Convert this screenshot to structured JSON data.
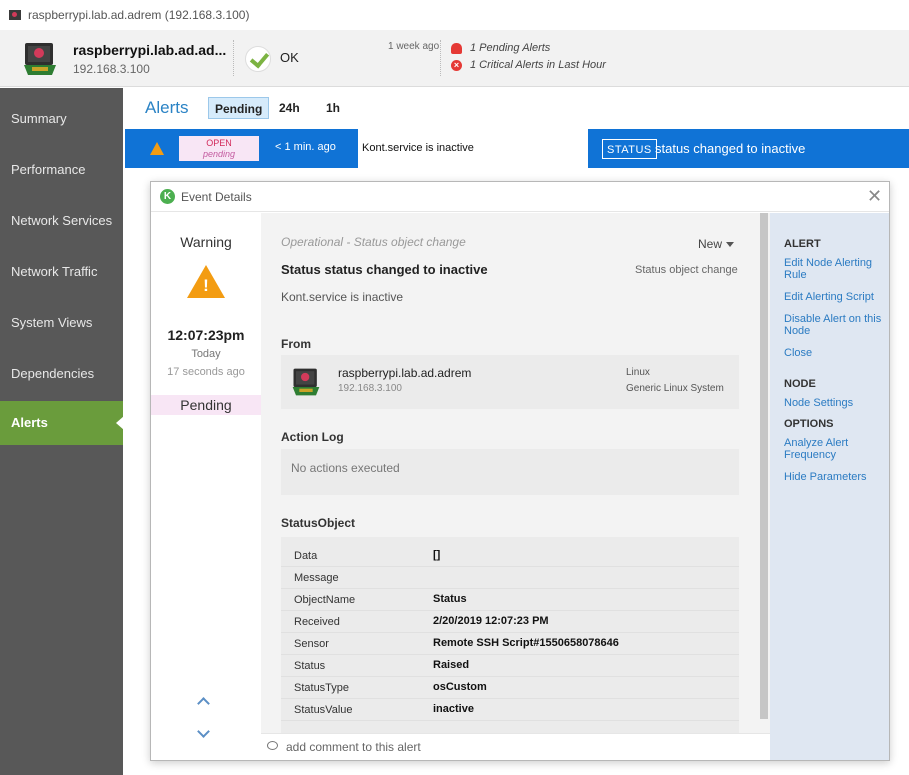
{
  "titlebar": {
    "text": "raspberrypi.lab.ad.adrem (192.168.3.100)"
  },
  "node": {
    "name": "raspberrypi.lab.ad.ad...",
    "ip": "192.168.3.100",
    "status": "OK",
    "status_age": "1 week ago",
    "pending_alerts": "1 Pending Alerts",
    "critical_alerts": "1 Critical Alerts in Last Hour"
  },
  "sidebar": {
    "items": [
      {
        "label": "Summary"
      },
      {
        "label": "Performance"
      },
      {
        "label": "Network Services"
      },
      {
        "label": "Network Traffic"
      },
      {
        "label": "System Views"
      },
      {
        "label": "Dependencies"
      },
      {
        "label": "Alerts"
      }
    ],
    "active": "Alerts"
  },
  "alerts_bar": {
    "title": "Alerts",
    "tabs": [
      {
        "label": "Pending"
      },
      {
        "label": "24h"
      },
      {
        "label": "1h"
      }
    ],
    "active_tab": "Pending"
  },
  "alert_row": {
    "state_top": "OPEN",
    "state_bottom": "pending",
    "age": "< 1 min. ago",
    "message": "Kont.service is inactive",
    "tag": "STATUS",
    "status_text": "status changed to  inactive"
  },
  "modal": {
    "title": "Event Details",
    "severity": "Warning",
    "time": "12:07:23pm",
    "day": "Today",
    "ago": "17 seconds ago",
    "state": "Pending",
    "category": "Operational - Status object change",
    "new_label": "New",
    "event_title": "Status status changed to inactive",
    "event_type": "Status object change",
    "description": "Kont.service is inactive",
    "from_title": "From",
    "from": {
      "name": "raspberrypi.lab.ad.adrem",
      "ip": "192.168.3.100",
      "os": "Linux",
      "system": "Generic Linux System"
    },
    "action_log_title": "Action Log",
    "action_log_empty": "No actions executed",
    "status_object_title": "StatusObject",
    "status_object": [
      {
        "key": "Data",
        "value": "[]"
      },
      {
        "key": "Message",
        "value": ""
      },
      {
        "key": "ObjectName",
        "value": "Status"
      },
      {
        "key": "Received",
        "value": "2/20/2019 12:07:23 PM"
      },
      {
        "key": "Sensor",
        "value": "Remote SSH Script#1550658078646"
      },
      {
        "key": "Status",
        "value": "Raised"
      },
      {
        "key": "StatusType",
        "value": "osCustom"
      },
      {
        "key": "StatusValue",
        "value": "inactive"
      }
    ],
    "right_panel": {
      "alert_head": "ALERT",
      "edit_rule": "Edit Node Alerting Rule",
      "edit_script": "Edit Alerting Script",
      "disable": "Disable Alert on this Node",
      "close": "Close",
      "node_head": "NODE",
      "node_settings": "Node Settings",
      "options_head": "OPTIONS",
      "analyze": "Analyze Alert Frequency",
      "hide_params": "Hide Parameters"
    },
    "comment_placeholder": "add comment to this alert"
  },
  "colors": {
    "accent_blue": "#1073d6",
    "sidebar_bg": "#585858",
    "sidebar_active": "#6a9c3c",
    "warning": "#f39c12",
    "pending_pink": "#f8e6f5",
    "link": "#2b7bc2"
  },
  "icons": [
    "raspberry-pi-icon",
    "ok-check-icon",
    "bell-icon",
    "critical-x-icon",
    "warning-icon",
    "k-logo-icon",
    "close-icon",
    "chevron-up-icon",
    "chevron-down-icon",
    "comment-icon"
  ]
}
